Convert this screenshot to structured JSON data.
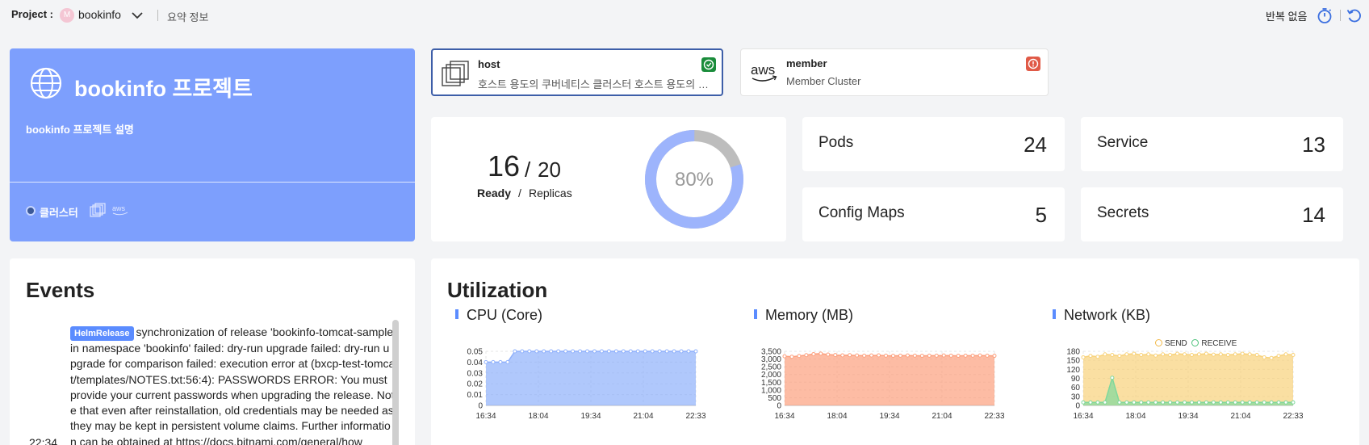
{
  "topbar": {
    "project_label": "Project :",
    "project_avatar": "M",
    "project_name": "bookinfo",
    "summary": "요약 정보",
    "repeat": "반복 없음"
  },
  "project": {
    "title": "bookinfo 프로젝트",
    "description": "bookinfo 프로젝트 설명",
    "cluster_label": "클러스터",
    "aws_text": "aws"
  },
  "clusters": [
    {
      "name": "host",
      "description": "호스트 용도의 쿠버네티스 클러스터 호스트 용도의 쿠버네티스 클러스터",
      "status": "ok",
      "status_color": "#1a8c3b"
    },
    {
      "name": "member",
      "description": "Member Cluster",
      "status": "error",
      "status_color": "#e05a47",
      "logo_text": "aws"
    }
  ],
  "replicas": {
    "ready": "16",
    "slash": "/",
    "total": "20",
    "ready_label": "Ready",
    "separator": "/",
    "replicas_label": "Replicas",
    "percent": "80%",
    "fraction": 0.8
  },
  "stats": {
    "pods": {
      "label": "Pods",
      "value": "24"
    },
    "service": {
      "label": "Service",
      "value": "13"
    },
    "configmaps": {
      "label": "Config Maps",
      "value": "5"
    },
    "secrets": {
      "label": "Secrets",
      "value": "14"
    }
  },
  "events": {
    "title": "Events",
    "badge": "HelmRelease",
    "message": "synchronization of release 'bookinfo-tomcat-sample' in namespace 'bookinfo' failed: dry-run upgrade failed: dry-run upgrade for comparison failed: execution error at (bxcp-test-tomcat/templates/NOTES.txt:56:4): PASSWORDS ERROR: You must provide your current passwords when upgrading the release. Note that even after reinstallation, old credentials may be needed as they may be kept in persistent volume claims. Further information can be obtained at https://docs.bitnami.com/general/how",
    "time": "22:34"
  },
  "utilization": {
    "title": "Utilization",
    "cpu_title": "CPU (Core)",
    "memory_title": "Memory (MB)",
    "network_title": "Network (KB)",
    "send_label": "SEND",
    "receive_label": "RECEIVE"
  },
  "chart_data": [
    {
      "type": "area",
      "title": "CPU (Core)",
      "x_ticks": [
        "16:34",
        "18:04",
        "19:34",
        "21:04",
        "22:33"
      ],
      "y_ticks": [
        "0",
        "0.01",
        "0.02",
        "0.03",
        "0.04",
        "0.05"
      ],
      "ylim": [
        0,
        0.05
      ],
      "color": "#8fb0fb",
      "series": [
        {
          "values": [
            0.04,
            0.04,
            0.04,
            0.04,
            0.05,
            0.05,
            0.05,
            0.05,
            0.05,
            0.05,
            0.05,
            0.05,
            0.05,
            0.05,
            0.05,
            0.05,
            0.05,
            0.05,
            0.05,
            0.05,
            0.05,
            0.05,
            0.05,
            0.05,
            0.05,
            0.05,
            0.05,
            0.05,
            0.05,
            0.05
          ]
        }
      ]
    },
    {
      "type": "area",
      "title": "Memory (MB)",
      "x_ticks": [
        "16:34",
        "18:04",
        "19:34",
        "21:04",
        "22:33"
      ],
      "y_ticks": [
        "0",
        "500",
        "1,000",
        "1,500",
        "2,000",
        "2,500",
        "3,000",
        "3,500"
      ],
      "ylim": [
        0,
        3500
      ],
      "color": "#fca07e",
      "series": [
        {
          "values": [
            3180,
            3150,
            3200,
            3250,
            3320,
            3350,
            3290,
            3260,
            3240,
            3250,
            3230,
            3220,
            3230,
            3240,
            3220,
            3210,
            3220,
            3230,
            3220,
            3210,
            3220,
            3220,
            3230,
            3220,
            3210,
            3220,
            3220,
            3230,
            3220,
            3210
          ]
        }
      ]
    },
    {
      "type": "area",
      "title": "Network (KB)",
      "x_ticks": [
        "16:34",
        "18:04",
        "19:34",
        "21:04",
        "22:33"
      ],
      "y_ticks": [
        "0",
        "30",
        "60",
        "90",
        "120",
        "150",
        "180"
      ],
      "ylim": [
        0,
        180
      ],
      "legend": [
        "SEND",
        "RECEIVE"
      ],
      "series": [
        {
          "name": "SEND",
          "color": "#f8d27a",
          "values": [
            160,
            165,
            162,
            170,
            168,
            165,
            170,
            172,
            168,
            170,
            166,
            170,
            168,
            172,
            170,
            168,
            170,
            172,
            169,
            170,
            168,
            170,
            172,
            170,
            168,
            160,
            158,
            165,
            170,
            168
          ]
        },
        {
          "name": "RECEIVE",
          "color": "#7fd89c",
          "values": [
            10,
            10,
            10,
            10,
            92,
            10,
            10,
            10,
            10,
            10,
            10,
            10,
            10,
            10,
            10,
            10,
            10,
            10,
            10,
            10,
            10,
            10,
            10,
            10,
            10,
            10,
            10,
            10,
            10,
            10
          ]
        }
      ]
    }
  ]
}
